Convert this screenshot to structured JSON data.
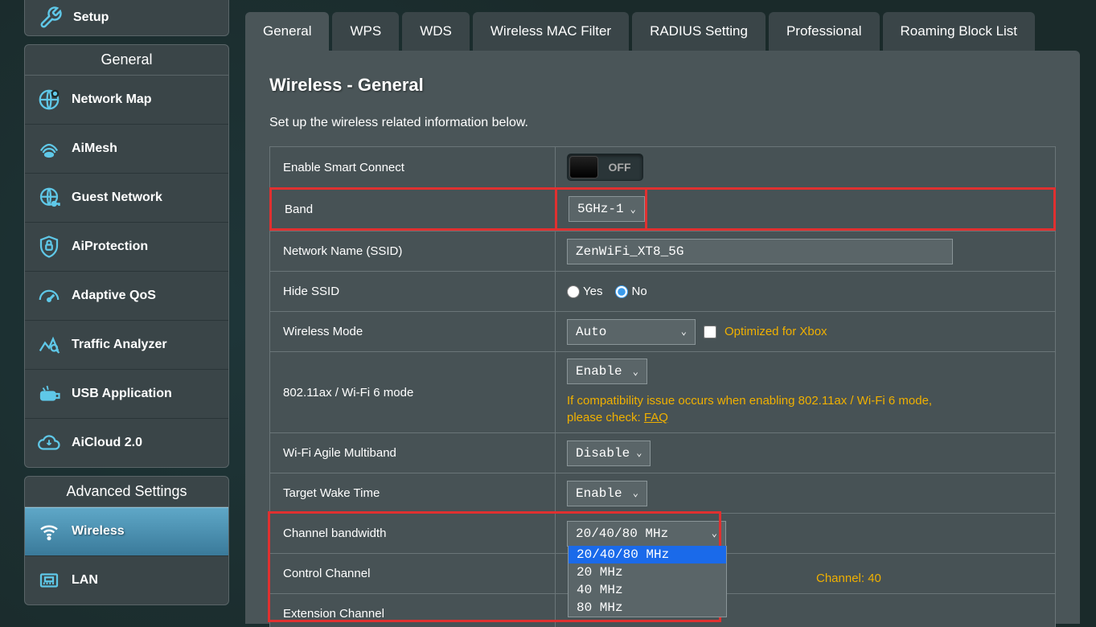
{
  "sidebar": {
    "setup_label": "Setup",
    "general_title": "General",
    "advanced_title": "Advanced Settings",
    "items": [
      {
        "label": "Network Map"
      },
      {
        "label": "AiMesh"
      },
      {
        "label": "Guest Network"
      },
      {
        "label": "AiProtection"
      },
      {
        "label": "Adaptive QoS"
      },
      {
        "label": "Traffic Analyzer"
      },
      {
        "label": "USB Application"
      },
      {
        "label": "AiCloud 2.0"
      }
    ],
    "advanced_items": [
      {
        "label": "Wireless"
      },
      {
        "label": "LAN"
      }
    ]
  },
  "tabs": [
    "General",
    "WPS",
    "WDS",
    "Wireless MAC Filter",
    "RADIUS Setting",
    "Professional",
    "Roaming Block List"
  ],
  "panel": {
    "title": "Wireless - General",
    "desc": "Set up the wireless related information below.",
    "smart_connect_label": "Enable Smart Connect",
    "smart_connect_value": "OFF",
    "band_label": "Band",
    "band_value": "5GHz-1",
    "ssid_label": "Network Name (SSID)",
    "ssid_value": "ZenWiFi_XT8_5G",
    "hide_ssid_label": "Hide SSID",
    "hide_ssid_yes": "Yes",
    "hide_ssid_no": "No",
    "wireless_mode_label": "Wireless Mode",
    "wireless_mode_value": "Auto",
    "xbox_hint": "Optimized for Xbox",
    "wifi6_label": "802.11ax / Wi-Fi 6 mode",
    "wifi6_value": "Enable",
    "wifi6_hint_pre": "If compatibility issue occurs when enabling 802.11ax / Wi-Fi 6 mode, please check: ",
    "wifi6_hint_link": "FAQ",
    "agile_label": "Wi-Fi Agile Multiband",
    "agile_value": "Disable",
    "twt_label": "Target Wake Time",
    "twt_value": "Enable",
    "chanbw_label": "Channel bandwidth",
    "chanbw_value": "20/40/80 MHz",
    "chanbw_options": [
      "20/40/80 MHz",
      "20 MHz",
      "40 MHz",
      "80 MHz"
    ],
    "control_ch_label": "Control Channel",
    "control_ch_hint": "Channel: 40",
    "ext_ch_label": "Extension Channel"
  }
}
